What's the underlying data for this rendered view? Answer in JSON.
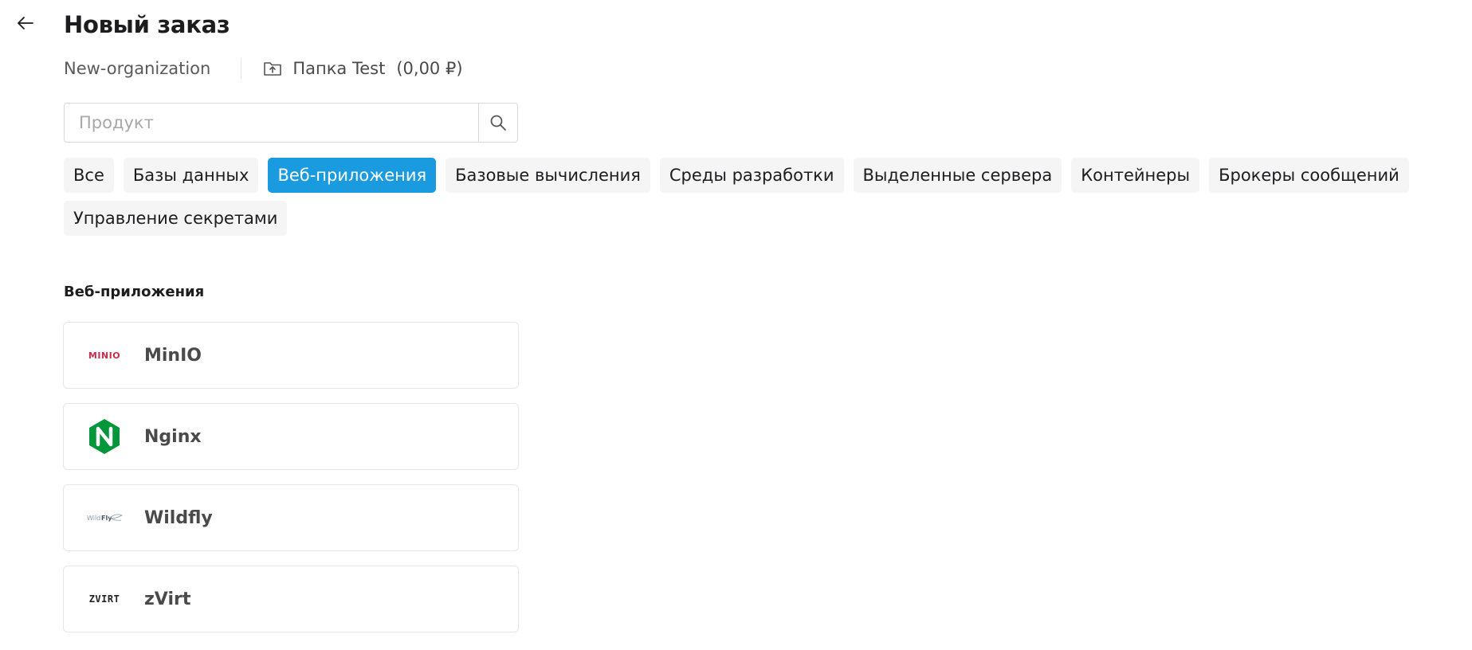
{
  "header": {
    "title": "Новый заказ",
    "back_icon": "arrow-left-icon"
  },
  "context": {
    "organization": "New-organization",
    "folder_icon": "folder-upload-icon",
    "folder_name": "Папка Test",
    "folder_balance": "(0,00 ₽)"
  },
  "search": {
    "placeholder": "Продукт",
    "value": "",
    "icon": "search-icon"
  },
  "categories": [
    {
      "label": "Все",
      "active": false
    },
    {
      "label": "Базы данных",
      "active": false
    },
    {
      "label": "Веб-приложения",
      "active": true
    },
    {
      "label": "Базовые вычисления",
      "active": false
    },
    {
      "label": "Среды разработки",
      "active": false
    },
    {
      "label": "Выделенные сервера",
      "active": false
    },
    {
      "label": "Контейнеры",
      "active": false
    },
    {
      "label": "Брокеры сообщений",
      "active": false
    },
    {
      "label": "Управление секретами",
      "active": false
    }
  ],
  "section": {
    "title": "Веб-приложения"
  },
  "products": [
    {
      "name": "MinIO",
      "logo": "minio-logo",
      "logo_text": "MINIO"
    },
    {
      "name": "Nginx",
      "logo": "nginx-logo",
      "logo_text": "N"
    },
    {
      "name": "Wildfly",
      "logo": "wildfly-logo",
      "logo_text": "WildFly"
    },
    {
      "name": "zVirt",
      "logo": "zvirt-logo",
      "logo_text": "ZVIRT"
    }
  ],
  "colors": {
    "accent": "#1a9be0",
    "chip_bg": "#f5f5f5",
    "minio": "#c72c48",
    "nginx": "#009639"
  }
}
